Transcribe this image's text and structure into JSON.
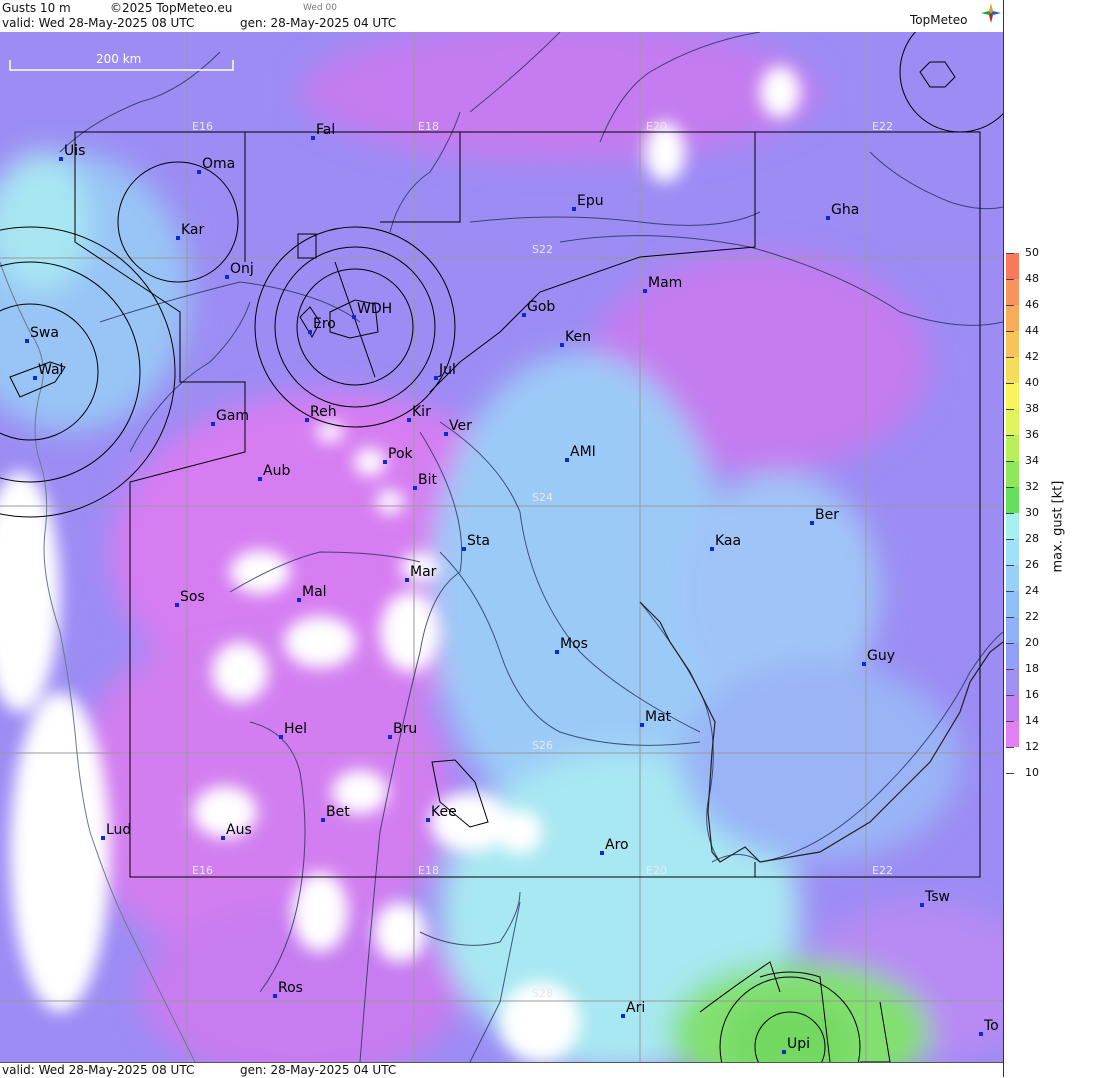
{
  "header": {
    "line1_left": "Gusts 10 m",
    "copyright": "©2025 TopMeteo.eu",
    "day_tag": "Wed 00",
    "valid": "valid:  Wed  28-May-2025  08 UTC",
    "gen": "gen: 28-May-2025 04 UTC",
    "logo_text": "TopMeteo"
  },
  "footer": {
    "valid": "valid:  Wed  28-May-2025  08 UTC",
    "gen": "gen: 28-May-2025 04 UTC"
  },
  "scale_bar": {
    "label": "200 km"
  },
  "grid_labels": {
    "lon": [
      "E16",
      "E18",
      "E20",
      "E22"
    ],
    "lat": [
      "S22",
      "S24",
      "S26",
      "S28"
    ]
  },
  "places": [
    {
      "name": "Uis"
    },
    {
      "name": "Oma"
    },
    {
      "name": "Fal"
    },
    {
      "name": "Kar"
    },
    {
      "name": "Epu"
    },
    {
      "name": "Gha"
    },
    {
      "name": "Onj"
    },
    {
      "name": "Mam"
    },
    {
      "name": "Swa"
    },
    {
      "name": "Gob"
    },
    {
      "name": "WDH"
    },
    {
      "name": "Ero"
    },
    {
      "name": "Ken"
    },
    {
      "name": "Wal"
    },
    {
      "name": "Jul"
    },
    {
      "name": "Gam"
    },
    {
      "name": "Reh"
    },
    {
      "name": "Kir"
    },
    {
      "name": "Ver"
    },
    {
      "name": "AMI"
    },
    {
      "name": "Pok"
    },
    {
      "name": "Aub"
    },
    {
      "name": "Bit"
    },
    {
      "name": "Ber"
    },
    {
      "name": "Sta"
    },
    {
      "name": "Kaa"
    },
    {
      "name": "Mar"
    },
    {
      "name": "Sos"
    },
    {
      "name": "Mal"
    },
    {
      "name": "Mos"
    },
    {
      "name": "Guy"
    },
    {
      "name": "Mat"
    },
    {
      "name": "Hel"
    },
    {
      "name": "Bru"
    },
    {
      "name": "Bet"
    },
    {
      "name": "Kee"
    },
    {
      "name": "Lud"
    },
    {
      "name": "Aus"
    },
    {
      "name": "Aro"
    },
    {
      "name": "Tsw"
    },
    {
      "name": "Ros"
    },
    {
      "name": "Ari"
    },
    {
      "name": "To"
    },
    {
      "name": "Upi"
    }
  ],
  "legend": {
    "title": "max. gust [kt]",
    "labels": [
      "50",
      "48",
      "46",
      "44",
      "42",
      "40",
      "38",
      "36",
      "34",
      "32",
      "30",
      "28",
      "26",
      "24",
      "22",
      "20",
      "18",
      "16",
      "14",
      "12",
      "10"
    ],
    "colors": [
      "#f77a5c",
      "#f7935c",
      "#f7ac5c",
      "#f7c45c",
      "#f7dc5c",
      "#f7f45c",
      "#dff45c",
      "#b8f05c",
      "#8fe85c",
      "#66e05c",
      "#a8f0f0",
      "#a0e0f8",
      "#98d0f8",
      "#90c0f8",
      "#90b0f8",
      "#90a0f8",
      "#a090f4",
      "#c080f4",
      "#e080f4",
      "#ffffff"
    ]
  }
}
